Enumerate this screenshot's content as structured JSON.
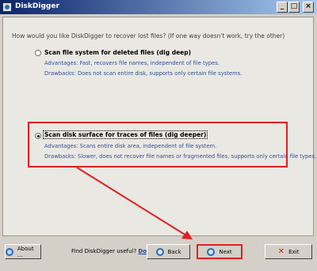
{
  "window": {
    "title": "DiskDigger"
  },
  "titlebar": {
    "minimize": "_",
    "maximize": "□",
    "close": "×"
  },
  "question": "How would you like DiskDigger to recover lost files? (If one way doesn't work, try the other)",
  "options": [
    {
      "title": "Scan file system for deleted files (dig deep)",
      "advantages": "Advantages: Fast, recovers file names, independent of file types.",
      "drawbacks": "Drawbacks: Does not scan entire disk, supports only certain file systems."
    },
    {
      "title": "Scan disk surface for traces of files (dig deeper)",
      "advantages": "Advantages: Scans entire disk area, independent of file system.",
      "drawbacks": "Drawbacks: Slower, does not recover file names or fragmented files, supports only certain file types."
    }
  ],
  "footer": {
    "about_label": "About ...",
    "prompt": "Find DiskDigger useful?",
    "donate_label": "Donate today!",
    "back_label": "Back",
    "next_label": "Next",
    "exit_label": "Exit"
  },
  "colors": {
    "highlight": "#e02020",
    "accent": "#2e4e9a"
  }
}
